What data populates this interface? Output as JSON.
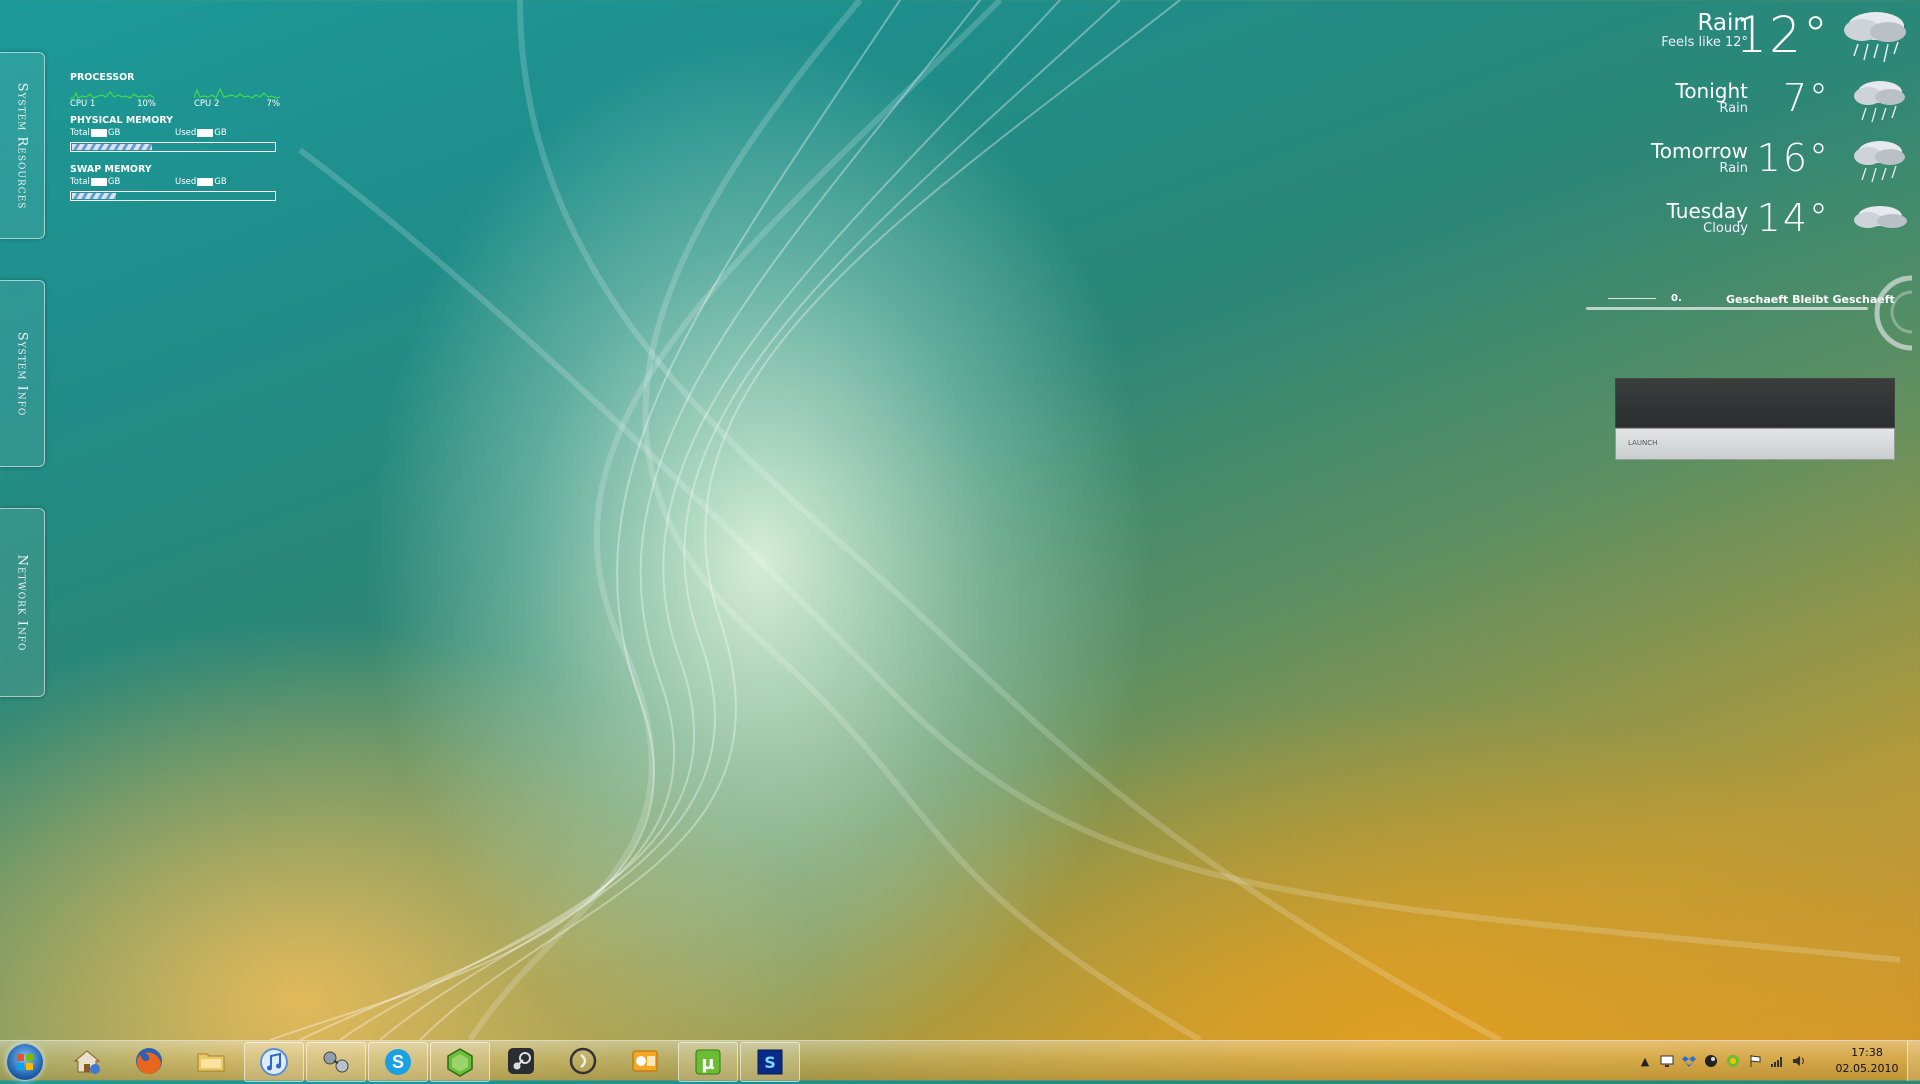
{
  "side_tabs": [
    {
      "label": "System Resources"
    },
    {
      "label": "System Info"
    },
    {
      "label": "Network Info"
    }
  ],
  "resources": {
    "processor_heading": "PROCESSOR",
    "cpu1_label": "CPU 1",
    "cpu1_value": "10%",
    "cpu2_label": "CPU 2",
    "cpu2_value": "7%",
    "physical_heading": "PHYSICAL MEMORY",
    "physical_total_label": "Total",
    "physical_used_label": "Used",
    "physical_unit": "GB",
    "physical_fill": 0.4,
    "swap_heading": "SWAP MEMORY",
    "swap_total_label": "Total",
    "swap_used_label": "Used",
    "swap_unit": "GB",
    "swap_fill": 0.22
  },
  "weather": {
    "current": {
      "title": "Rain",
      "subtitle": "Feels like 12°",
      "temp": "12°",
      "icon": "rain-cloud-icon"
    },
    "forecast": [
      {
        "title": "Tonight",
        "subtitle": "Rain",
        "temp": "7°",
        "icon": "rain-cloud-icon"
      },
      {
        "title": "Tomorrow",
        "subtitle": "Rain",
        "temp": "16°",
        "icon": "rain-cloud-icon"
      },
      {
        "title": "Tuesday",
        "subtitle": "Cloudy",
        "temp": "14°",
        "icon": "cloud-icon"
      }
    ]
  },
  "music": {
    "track_number": "0.",
    "track_title": "Geschaeft Bleibt Geschaeft"
  },
  "launcher": {
    "label": "LAUNCH"
  },
  "taskbar": {
    "items": [
      {
        "name": "start-button",
        "icon": "windows-orb-icon"
      },
      {
        "name": "taskbar-item-home-network",
        "icon": "home-network-icon",
        "active": false
      },
      {
        "name": "taskbar-item-firefox",
        "icon": "firefox-icon",
        "active": false
      },
      {
        "name": "taskbar-item-explorer",
        "icon": "folder-icon",
        "active": false
      },
      {
        "name": "taskbar-item-itunes",
        "icon": "itunes-icon",
        "active": true
      },
      {
        "name": "taskbar-item-network-tool",
        "icon": "network-tool-icon",
        "active": true
      },
      {
        "name": "taskbar-item-skype",
        "icon": "skype-icon",
        "active": true
      },
      {
        "name": "taskbar-item-hexagon-app",
        "icon": "hexagon-app-icon",
        "active": true
      },
      {
        "name": "taskbar-item-steam",
        "icon": "steam-icon",
        "active": false
      },
      {
        "name": "taskbar-item-audio-app",
        "icon": "audio-app-icon",
        "active": false
      },
      {
        "name": "taskbar-item-outlook",
        "icon": "outlook-icon",
        "active": false
      },
      {
        "name": "taskbar-item-utorrent",
        "icon": "utorrent-icon",
        "active": true
      },
      {
        "name": "taskbar-item-blue-app",
        "icon": "blue-app-icon",
        "active": true
      }
    ],
    "tray_icons": [
      "tray-expand-icon",
      "tray-monitor-icon",
      "tray-dropbox-icon",
      "tray-steam-icon",
      "tray-utorrent-icon",
      "tray-flag-icon",
      "tray-network-icon",
      "tray-volume-icon"
    ],
    "clock_time": "17:38",
    "clock_date": "02.05.2010"
  }
}
